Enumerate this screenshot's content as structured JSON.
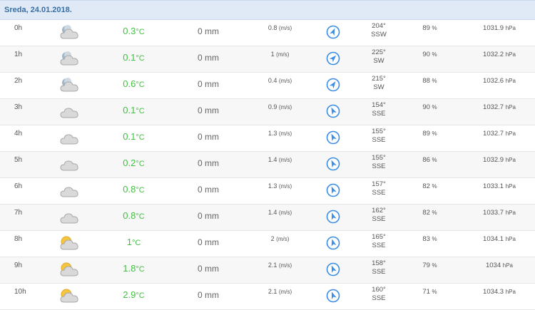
{
  "header": {
    "date": "Sreda, 24.01.2018."
  },
  "colors": {
    "temp": "#43c043",
    "arrow": "#3b8ee6",
    "header_bg": "#dfeaf6"
  },
  "units": {
    "temp": "°C",
    "wind": "(m/s)",
    "humidity": "%",
    "pressure": "hPa"
  },
  "rows": [
    {
      "hour": "0h",
      "icon": "partly-cloudy-night-icon",
      "temp": "0.3",
      "precip": "0 mm",
      "wind_speed": "0.8",
      "dir_deg": "204°",
      "dir_name": "SSW",
      "humidity": "89",
      "pressure": "1031.9"
    },
    {
      "hour": "1h",
      "icon": "partly-cloudy-night-icon",
      "temp": "0.1",
      "precip": "0 mm",
      "wind_speed": "1",
      "dir_deg": "225°",
      "dir_name": "SW",
      "humidity": "90",
      "pressure": "1032.2"
    },
    {
      "hour": "2h",
      "icon": "partly-cloudy-night-icon",
      "temp": "0.6",
      "precip": "0 mm",
      "wind_speed": "0.4",
      "dir_deg": "215°",
      "dir_name": "SW",
      "humidity": "88",
      "pressure": "1032.6"
    },
    {
      "hour": "3h",
      "icon": "cloud-icon",
      "temp": "0.1",
      "precip": "0 mm",
      "wind_speed": "0.9",
      "dir_deg": "154°",
      "dir_name": "SSE",
      "humidity": "90",
      "pressure": "1032.7"
    },
    {
      "hour": "4h",
      "icon": "cloud-icon",
      "temp": "0.1",
      "precip": "0 mm",
      "wind_speed": "1.3",
      "dir_deg": "155°",
      "dir_name": "SSE",
      "humidity": "89",
      "pressure": "1032.7"
    },
    {
      "hour": "5h",
      "icon": "cloud-icon",
      "temp": "0.2",
      "precip": "0 mm",
      "wind_speed": "1.4",
      "dir_deg": "155°",
      "dir_name": "SSE",
      "humidity": "86",
      "pressure": "1032.9"
    },
    {
      "hour": "6h",
      "icon": "cloud-icon",
      "temp": "0.8",
      "precip": "0 mm",
      "wind_speed": "1.3",
      "dir_deg": "157°",
      "dir_name": "SSE",
      "humidity": "82",
      "pressure": "1033.1"
    },
    {
      "hour": "7h",
      "icon": "cloud-icon",
      "temp": "0.8",
      "precip": "0 mm",
      "wind_speed": "1.4",
      "dir_deg": "162°",
      "dir_name": "SSE",
      "humidity": "82",
      "pressure": "1033.7"
    },
    {
      "hour": "8h",
      "icon": "partly-sunny-icon",
      "temp": "1",
      "precip": "0 mm",
      "wind_speed": "2",
      "dir_deg": "165°",
      "dir_name": "SSE",
      "humidity": "83",
      "pressure": "1034.1"
    },
    {
      "hour": "9h",
      "icon": "partly-sunny-icon",
      "temp": "1.8",
      "precip": "0 mm",
      "wind_speed": "2.1",
      "dir_deg": "158°",
      "dir_name": "SSE",
      "humidity": "79",
      "pressure": "1034"
    },
    {
      "hour": "10h",
      "icon": "partly-sunny-icon",
      "temp": "2.9",
      "precip": "0 mm",
      "wind_speed": "2.1",
      "dir_deg": "160°",
      "dir_name": "SSE",
      "humidity": "71",
      "pressure": "1034.3"
    }
  ]
}
